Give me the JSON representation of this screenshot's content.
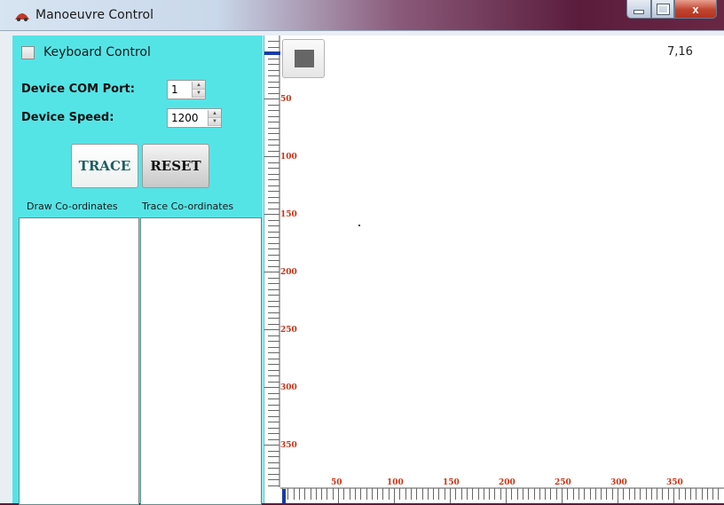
{
  "window": {
    "title": "Manoeuvre Control",
    "controls": [
      "minimize",
      "maximize",
      "close"
    ],
    "close_glyph": "x"
  },
  "left_panel": {
    "background": "#55e4e6",
    "keyboard_control": {
      "label": "Keyboard Control",
      "checked": false
    },
    "com_port": {
      "label": "Device COM Port:",
      "value": "1"
    },
    "speed": {
      "label": "Device Speed:",
      "value": "1200"
    },
    "buttons": {
      "trace": "TRACE",
      "reset": "RESET"
    },
    "columns": {
      "draw": "Draw Co-ordinates",
      "trace": "Trace Co-ordinates"
    }
  },
  "canvas": {
    "coordinate_readout": "7,16",
    "stop_button": "stop-icon",
    "ruler_vertical_labels": [
      "50",
      "100",
      "150",
      "200",
      "250",
      "300",
      "350"
    ],
    "ruler_horizontal_labels": [
      "50",
      "100",
      "150",
      "200",
      "250",
      "300",
      "350"
    ],
    "ruler_label_color": "#d03010",
    "position_marker_color": "#1a3aaa"
  }
}
